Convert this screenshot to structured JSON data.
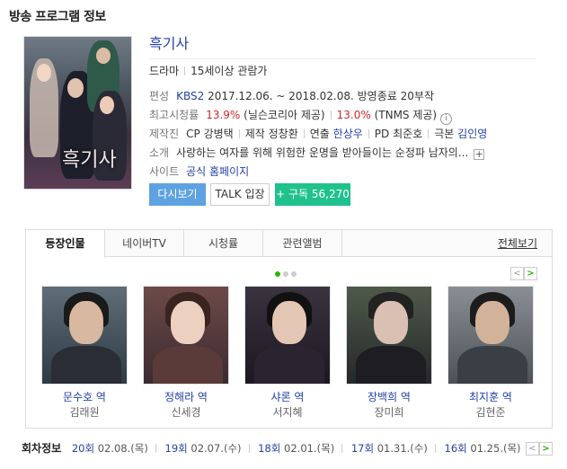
{
  "section_title": "방송 프로그램 정보",
  "poster": {
    "title_art": "흑기사"
  },
  "program": {
    "title": "흑기사",
    "genre": "드라마",
    "rating": "15세이상 관람가",
    "schedule": {
      "label": "편성",
      "channel": "KBS2",
      "period": "2017.12.06. ~ 2018.02.08.",
      "status": "방영종료",
      "episodes": "20부작"
    },
    "viewership": {
      "label": "최고시청률",
      "nielsen_value": "13.9%",
      "nielsen_src": "(닐슨코리아 제공)",
      "tnms_value": "13.0%",
      "tnms_src": "(TNMS 제공)",
      "info_icon": "i"
    },
    "crew": {
      "label": "제작진",
      "cp_label": "CP",
      "cp": "강병택",
      "prod_label": "제작",
      "prod": "정창환",
      "dir_label": "연출",
      "dir": "한상우",
      "pd_label": "PD",
      "pd": "최준호",
      "writer_label": "극본",
      "writer": "김인영"
    },
    "synopsis": {
      "label": "소개",
      "text": "사랑하는 여자를 위해 위험한 운명을 받아들이는 순정파 남자의...",
      "more_icon": "+"
    },
    "site": {
      "label": "사이트",
      "link": "공식 홈페이지"
    }
  },
  "buttons": {
    "replay": "다시보기",
    "talk": "TALK 입장",
    "subscribe": "+ 구독 56,270"
  },
  "tabs": [
    {
      "label": "등장인물"
    },
    {
      "label": "네이버TV"
    },
    {
      "label": "시청률"
    },
    {
      "label": "관련앨범"
    }
  ],
  "tab_all": "전체보기",
  "pager": {
    "prev": "<",
    "next": ">"
  },
  "cast": [
    {
      "role": "문수호 역",
      "actor": "김래원"
    },
    {
      "role": "정해라 역",
      "actor": "신세경"
    },
    {
      "role": "샤론 역",
      "actor": "서지혜"
    },
    {
      "role": "장백희 역",
      "actor": "장미희"
    },
    {
      "role": "최지훈 역",
      "actor": "김현준"
    }
  ],
  "episodes": {
    "label": "회차정보",
    "items": [
      {
        "ep": "20회",
        "date": "02.08.(목)"
      },
      {
        "ep": "19회",
        "date": "02.07.(수)"
      },
      {
        "ep": "18회",
        "date": "02.01.(목)"
      },
      {
        "ep": "17회",
        "date": "01.31.(수)"
      },
      {
        "ep": "16회",
        "date": "01.25.(목)"
      }
    ]
  },
  "colors": {
    "link": "#2442a8",
    "rating_red": "#d4242c",
    "replay_btn": "#5ea2e2",
    "subscribe_btn": "#1fc28c",
    "active_dot": "#2db400"
  }
}
